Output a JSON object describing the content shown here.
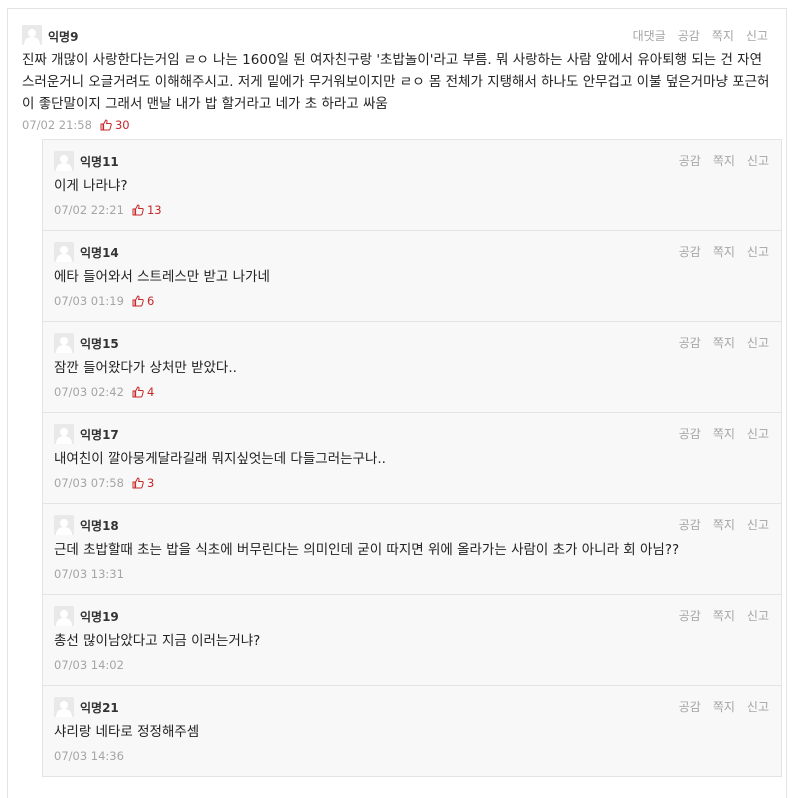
{
  "post": {
    "nickname": "익명9",
    "actions": [
      "대댓글",
      "공감",
      "쪽지",
      "신고"
    ],
    "content": "진짜 개많이 사랑한다는거임 ㄹㅇ 나는 1600일 된 여자친구랑 '초밥놀이'라고 부름. 뭐 사랑하는 사람 앞에서 유아퇴행 되는 건 자연스러운거니 오글거려도 이해해주시고. 저게 밑에가 무거워보이지만 ㄹㅇ 몸 전체가 지탱해서 하나도 안무겁고 이불 덮은거마냥 포근허이 좋단말이지 그래서 맨날 내가 밥 할거라고 네가 초 하라고 싸움",
    "timestamp": "07/02 21:58",
    "likes": "30"
  },
  "replies": [
    {
      "nickname": "익명11",
      "content": "이게 나라냐?",
      "timestamp": "07/02 22:21",
      "likes": "13",
      "actions": [
        "공감",
        "쪽지",
        "신고"
      ]
    },
    {
      "nickname": "익명14",
      "content": "에타 들어와서 스트레스만 받고 나가네",
      "timestamp": "07/03 01:19",
      "likes": "6",
      "actions": [
        "공감",
        "쪽지",
        "신고"
      ]
    },
    {
      "nickname": "익명15",
      "content": "잠깐 들어왔다가 상처만 받았다..",
      "timestamp": "07/03 02:42",
      "likes": "4",
      "actions": [
        "공감",
        "쪽지",
        "신고"
      ]
    },
    {
      "nickname": "익명17",
      "content": "내여친이 깔아뭉게달라길래 뭐지싶엇는데 다들그러는구나..",
      "timestamp": "07/03 07:58",
      "likes": "3",
      "actions": [
        "공감",
        "쪽지",
        "신고"
      ]
    },
    {
      "nickname": "익명18",
      "content": "근데 초밥할때 초는 밥을 식초에 버무린다는 의미인데 굳이 따지면 위에 올라가는 사람이 초가 아니라 회 아님??",
      "timestamp": "07/03 13:31",
      "likes": "",
      "actions": [
        "공감",
        "쪽지",
        "신고"
      ]
    },
    {
      "nickname": "익명19",
      "content": "총선 많이남았다고 지금 이러는거냐?",
      "timestamp": "07/03 14:02",
      "likes": "",
      "actions": [
        "공감",
        "쪽지",
        "신고"
      ]
    },
    {
      "nickname": "익명21",
      "content": "샤리랑 네타로 정정해주셈",
      "timestamp": "07/03 14:36",
      "likes": "",
      "actions": [
        "공감",
        "쪽지",
        "신고"
      ]
    }
  ],
  "icons": {
    "avatar": "anonymous-avatar-icon",
    "like": "thumbs-up-icon"
  },
  "colors": {
    "like": "#c62828",
    "meta": "#a5a5a5",
    "reply_bg": "#f8f8f8"
  }
}
